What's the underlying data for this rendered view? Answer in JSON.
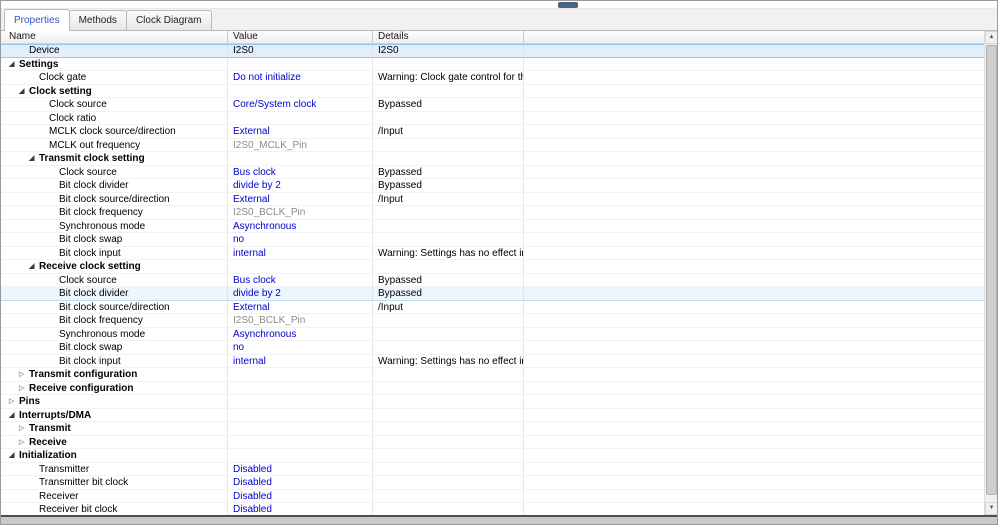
{
  "tabs": [
    {
      "label": "Properties",
      "active": true
    },
    {
      "label": "Methods",
      "active": false
    },
    {
      "label": "Clock Diagram",
      "active": false
    }
  ],
  "icons": {
    "expanded": "◢",
    "collapsed": "▷",
    "scroll_up": "▲",
    "scroll_down": "▼"
  },
  "colors": {
    "value_blue": "#0000cc",
    "value_gray": "#8a8a8a",
    "selection_bg": "#e2eefa",
    "selection_border": "#9cc7ec"
  },
  "table": {
    "columns": [
      "Name",
      "Value",
      "Details"
    ],
    "rows": [
      {
        "name": "Device",
        "value": "I2S0",
        "value_style": "black",
        "details": "I2S0",
        "indent": 1,
        "arrow": "none",
        "bold": false,
        "state": "selected"
      },
      {
        "name": "Settings",
        "value": "",
        "value_style": "blue",
        "details": "",
        "indent": 0,
        "arrow": "expanded",
        "bold": true,
        "state": ""
      },
      {
        "name": "Clock gate",
        "value": "Do not initialize",
        "value_style": "blue",
        "details": "Warning: Clock gate control for th...",
        "indent": 2,
        "arrow": "none",
        "bold": false,
        "state": ""
      },
      {
        "name": "Clock setting",
        "value": "",
        "value_style": "blue",
        "details": "",
        "indent": 1,
        "arrow": "expanded",
        "bold": true,
        "state": ""
      },
      {
        "name": "Clock source",
        "value": "Core/System clock",
        "value_style": "blue",
        "details": "Bypassed",
        "indent": 3,
        "arrow": "none",
        "bold": false,
        "state": ""
      },
      {
        "name": "Clock ratio",
        "value": "",
        "value_style": "blue",
        "details": "",
        "indent": 3,
        "arrow": "none",
        "bold": false,
        "state": ""
      },
      {
        "name": "MCLK clock source/direction",
        "value": "External",
        "value_style": "blue",
        "details": "/Input",
        "indent": 3,
        "arrow": "none",
        "bold": false,
        "state": ""
      },
      {
        "name": "MCLK out frequency",
        "value": "I2S0_MCLK_Pin",
        "value_style": "gray",
        "details": "",
        "indent": 3,
        "arrow": "none",
        "bold": false,
        "state": ""
      },
      {
        "name": "Transmit clock setting",
        "value": "",
        "value_style": "blue",
        "details": "",
        "indent": 2,
        "arrow": "expanded",
        "bold": true,
        "state": ""
      },
      {
        "name": "Clock source",
        "value": "Bus clock",
        "value_style": "blue",
        "details": "Bypassed",
        "indent": 4,
        "arrow": "none",
        "bold": false,
        "state": ""
      },
      {
        "name": "Bit clock divider",
        "value": "divide by 2",
        "value_style": "blue",
        "details": "Bypassed",
        "indent": 4,
        "arrow": "none",
        "bold": false,
        "state": ""
      },
      {
        "name": "Bit clock source/direction",
        "value": "External",
        "value_style": "blue",
        "details": "/Input",
        "indent": 4,
        "arrow": "none",
        "bold": false,
        "state": ""
      },
      {
        "name": "Bit clock frequency",
        "value": "I2S0_BCLK_Pin",
        "value_style": "gray",
        "details": "",
        "indent": 4,
        "arrow": "none",
        "bold": false,
        "state": ""
      },
      {
        "name": "Synchronous mode",
        "value": "Asynchronous",
        "value_style": "blue",
        "details": "",
        "indent": 4,
        "arrow": "none",
        "bold": false,
        "state": ""
      },
      {
        "name": "Bit clock swap",
        "value": "no",
        "value_style": "blue",
        "details": "",
        "indent": 4,
        "arrow": "none",
        "bold": false,
        "state": ""
      },
      {
        "name": "Bit clock input",
        "value": "internal",
        "value_style": "blue",
        "details": "Warning: Settings has no effect in ...",
        "indent": 4,
        "arrow": "none",
        "bold": false,
        "state": ""
      },
      {
        "name": "Receive clock setting",
        "value": "",
        "value_style": "blue",
        "details": "",
        "indent": 2,
        "arrow": "expanded",
        "bold": true,
        "state": ""
      },
      {
        "name": "Clock source",
        "value": "Bus clock",
        "value_style": "blue",
        "details": "Bypassed",
        "indent": 4,
        "arrow": "none",
        "bold": false,
        "state": ""
      },
      {
        "name": "Bit clock divider",
        "value": "divide by 2",
        "value_style": "blue",
        "details": "Bypassed",
        "indent": 4,
        "arrow": "none",
        "bold": false,
        "state": "hover"
      },
      {
        "name": "Bit clock source/direction",
        "value": "External",
        "value_style": "blue",
        "details": "/Input",
        "indent": 4,
        "arrow": "none",
        "bold": false,
        "state": ""
      },
      {
        "name": "Bit clock frequency",
        "value": "I2S0_BCLK_Pin",
        "value_style": "gray",
        "details": "",
        "indent": 4,
        "arrow": "none",
        "bold": false,
        "state": ""
      },
      {
        "name": "Synchronous mode",
        "value": "Asynchronous",
        "value_style": "blue",
        "details": "",
        "indent": 4,
        "arrow": "none",
        "bold": false,
        "state": ""
      },
      {
        "name": "Bit clock swap",
        "value": "no",
        "value_style": "blue",
        "details": "",
        "indent": 4,
        "arrow": "none",
        "bold": false,
        "state": ""
      },
      {
        "name": "Bit clock input",
        "value": "internal",
        "value_style": "blue",
        "details": "Warning: Settings has no effect in ...",
        "indent": 4,
        "arrow": "none",
        "bold": false,
        "state": ""
      },
      {
        "name": "Transmit configuration",
        "value": "",
        "value_style": "blue",
        "details": "",
        "indent": 1,
        "arrow": "collapsed",
        "bold": true,
        "state": ""
      },
      {
        "name": "Receive configuration",
        "value": "",
        "value_style": "blue",
        "details": "",
        "indent": 1,
        "arrow": "collapsed",
        "bold": true,
        "state": ""
      },
      {
        "name": "Pins",
        "value": "",
        "value_style": "blue",
        "details": "",
        "indent": 0,
        "arrow": "collapsed",
        "bold": true,
        "state": ""
      },
      {
        "name": "Interrupts/DMA",
        "value": "",
        "value_style": "blue",
        "details": "",
        "indent": 0,
        "arrow": "expanded",
        "bold": true,
        "state": ""
      },
      {
        "name": "Transmit",
        "value": "",
        "value_style": "blue",
        "details": "",
        "indent": 1,
        "arrow": "collapsed",
        "bold": true,
        "state": ""
      },
      {
        "name": "Receive",
        "value": "",
        "value_style": "blue",
        "details": "",
        "indent": 1,
        "arrow": "collapsed",
        "bold": true,
        "state": ""
      },
      {
        "name": "Initialization",
        "value": "",
        "value_style": "blue",
        "details": "",
        "indent": 0,
        "arrow": "expanded",
        "bold": true,
        "state": ""
      },
      {
        "name": "Transmitter",
        "value": "Disabled",
        "value_style": "blue",
        "details": "",
        "indent": 2,
        "arrow": "none",
        "bold": false,
        "state": ""
      },
      {
        "name": "Transmitter bit clock",
        "value": "Disabled",
        "value_style": "blue",
        "details": "",
        "indent": 2,
        "arrow": "none",
        "bold": false,
        "state": ""
      },
      {
        "name": "Receiver",
        "value": "Disabled",
        "value_style": "blue",
        "details": "",
        "indent": 2,
        "arrow": "none",
        "bold": false,
        "state": ""
      },
      {
        "name": "Receiver bit clock",
        "value": "Disabled",
        "value_style": "blue",
        "details": "",
        "indent": 2,
        "arrow": "none",
        "bold": false,
        "state": ""
      }
    ]
  }
}
